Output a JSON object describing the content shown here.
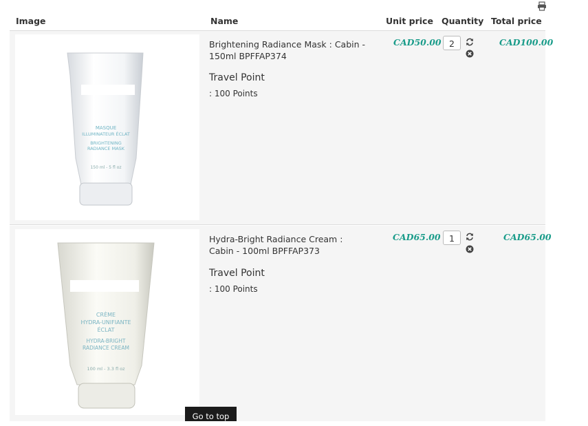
{
  "table": {
    "headers": {
      "image": "Image",
      "name": "Name",
      "unit_price": "Unit price",
      "quantity": "Quantity",
      "total_price": "Total price"
    }
  },
  "items": [
    {
      "name": "Brightening Radiance Mask : Cabin - 150ml BPFFAP374",
      "travel_point_label": "Travel Point",
      "travel_point_value": ": 100 Points",
      "unit_price": "CAD50.00",
      "quantity": "2",
      "total_price": "CAD100.00",
      "tube_lines": [
        "MASQUE",
        "ILLUMINATEUR ÉCLAT",
        "BRIGHTENING",
        "RADIANCE MASK",
        "150 ml - 5 fl oz"
      ]
    },
    {
      "name": "Hydra-Bright Radiance Cream : Cabin - 100ml BPFFAP373",
      "travel_point_label": "Travel Point",
      "travel_point_value": ": 100 Points",
      "unit_price": "CAD65.00",
      "quantity": "1",
      "total_price": "CAD65.00",
      "tube_lines": [
        "CRÈME",
        "HYDRA-UNIFIANTE",
        "ÉCLAT",
        "HYDRA-BRIGHT",
        "RADIANCE CREAM",
        "100 ml - 3.3 fl oz"
      ]
    }
  ],
  "icons": {
    "print": "print-icon",
    "update": "refresh-icon",
    "remove": "remove-icon"
  },
  "footer": {
    "go_to_top": "Go to top"
  }
}
